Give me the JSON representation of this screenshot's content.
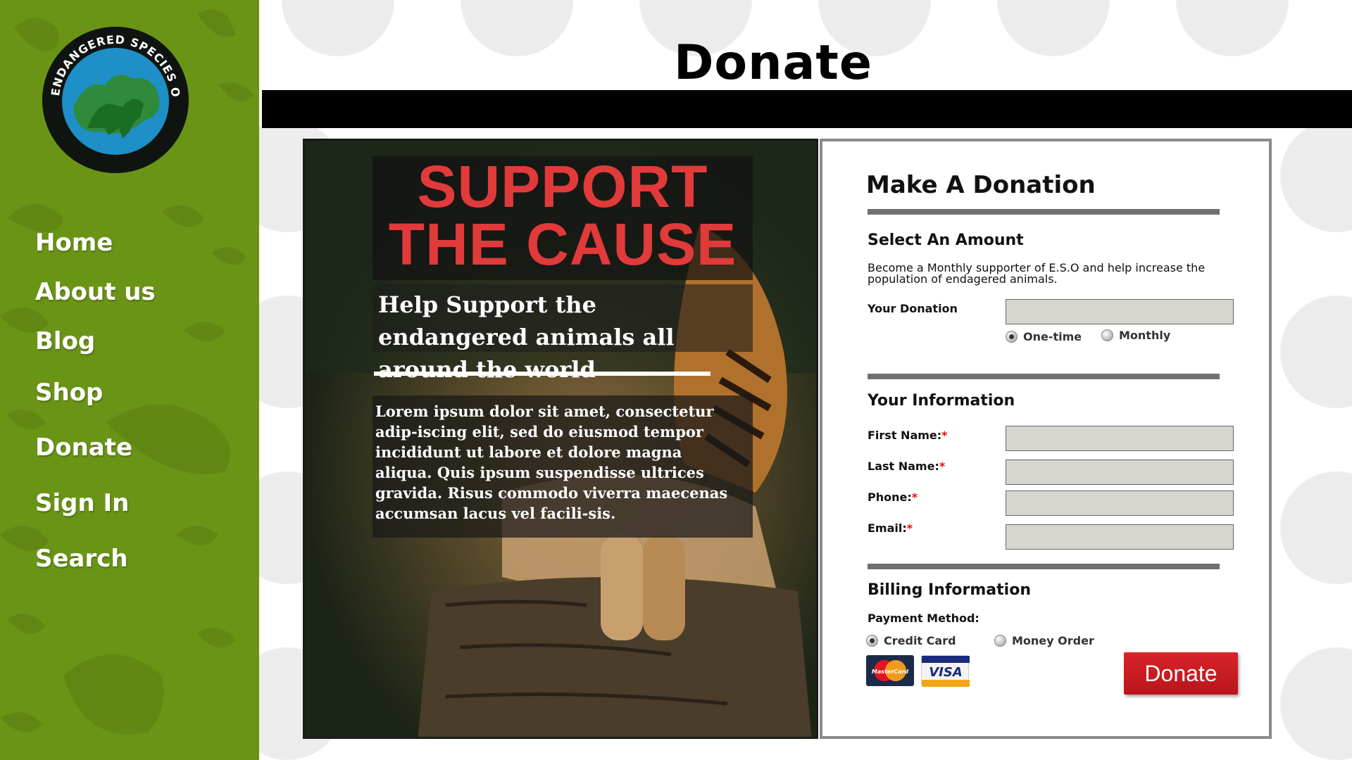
{
  "nav": {
    "items": [
      {
        "label": "Home"
      },
      {
        "label": "About us"
      },
      {
        "label": "Blog"
      },
      {
        "label": "Shop"
      },
      {
        "label": "Donate"
      },
      {
        "label": "Sign In"
      },
      {
        "label": "Search"
      }
    ]
  },
  "logo": {
    "text": "ENDANGERED SPECIES ORGANIZATION"
  },
  "page": {
    "title": "Donate"
  },
  "hero": {
    "headline_1": "SUPPORT",
    "headline_2": "THE CAUSE",
    "subhead": "Help Support the endangered animals all around the world",
    "body": "Lorem ipsum dolor sit amet, consectetur adip-iscing elit, sed do eiusmod tempor incididunt ut labore et dolore magna aliqua. Quis ipsum suspendisse ultrices gravida. Risus commodo viverra maecenas accumsan lacus vel facili-sis."
  },
  "form": {
    "title": "Make A Donation",
    "amount": {
      "heading": "Select An Amount",
      "description": "Become a Monthly supporter of E.S.O and help increase the population of endagered animals.",
      "donation_label": "Your Donation",
      "donation_value": "",
      "one_time_label": "One-time",
      "monthly_label": "Monthly",
      "selected": "one-time"
    },
    "info": {
      "heading": "Your Information",
      "first_name_label": "First Name:",
      "last_name_label": "Last Name:",
      "phone_label": "Phone:",
      "email_label": "Email:",
      "required_mark": "*"
    },
    "billing": {
      "heading": "Billing Information",
      "payment_label": "Payment Method:",
      "credit_card_label": "Credit Card",
      "money_order_label": "Money Order",
      "selected": "credit-card",
      "cards": {
        "mastercard": "MasterCard",
        "visa": "VISA"
      }
    },
    "submit_label": "Donate"
  },
  "colors": {
    "sidebar_green": "#6a9416",
    "headline_red": "#e13a3a",
    "button_red": "#d9232a",
    "input_bg": "#d6d5ce",
    "logo_blue": "#1e8fc7"
  },
  "icons": [
    "logo-emblem-icon",
    "mastercard-icon",
    "visa-icon"
  ]
}
